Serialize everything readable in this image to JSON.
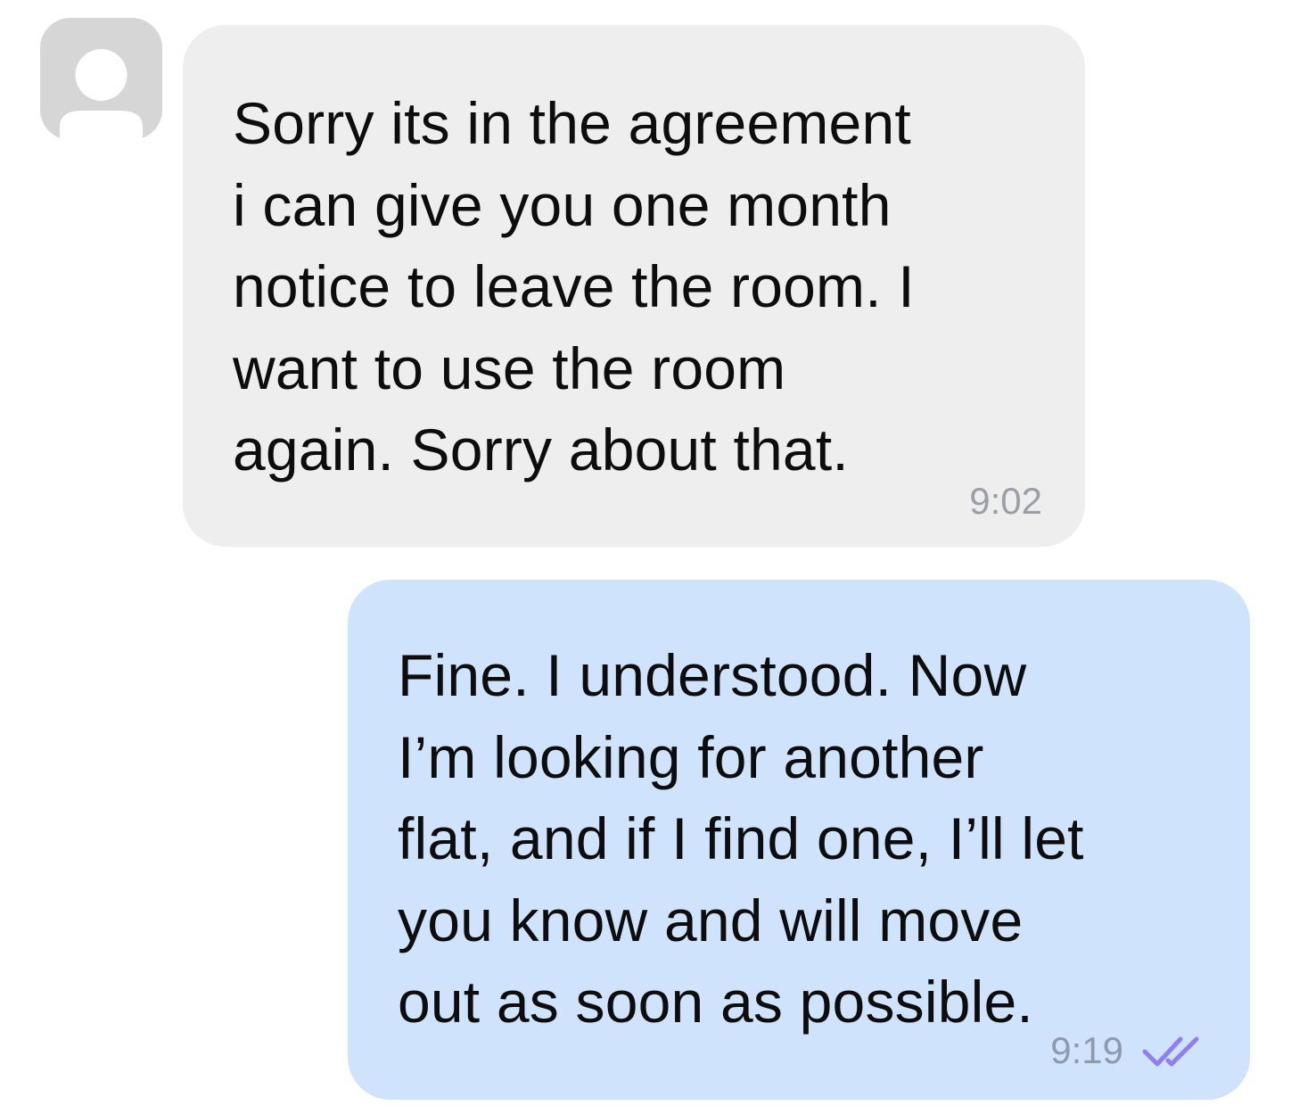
{
  "messages": [
    {
      "direction": "incoming",
      "text": "Sorry its in the agreement\ni can give you one month\nnotice to leave the room. I\nwant to use the room\nagain. Sorry about that.",
      "time": "9:02",
      "avatar_icon": "default-user-avatar"
    },
    {
      "direction": "outgoing",
      "text": "Fine. I understood. Now\nI’m looking for another\nflat, and if I find one, I’ll let\nyou know and will move\nout as soon as possible.",
      "time": "9:19",
      "status_icon": "double-check-read-icon"
    }
  ],
  "colors": {
    "incoming_bubble": "#eeeeee",
    "outgoing_bubble": "#cfe3fc",
    "read_check": "#8f7ff0",
    "avatar": "#d6d6d6"
  }
}
